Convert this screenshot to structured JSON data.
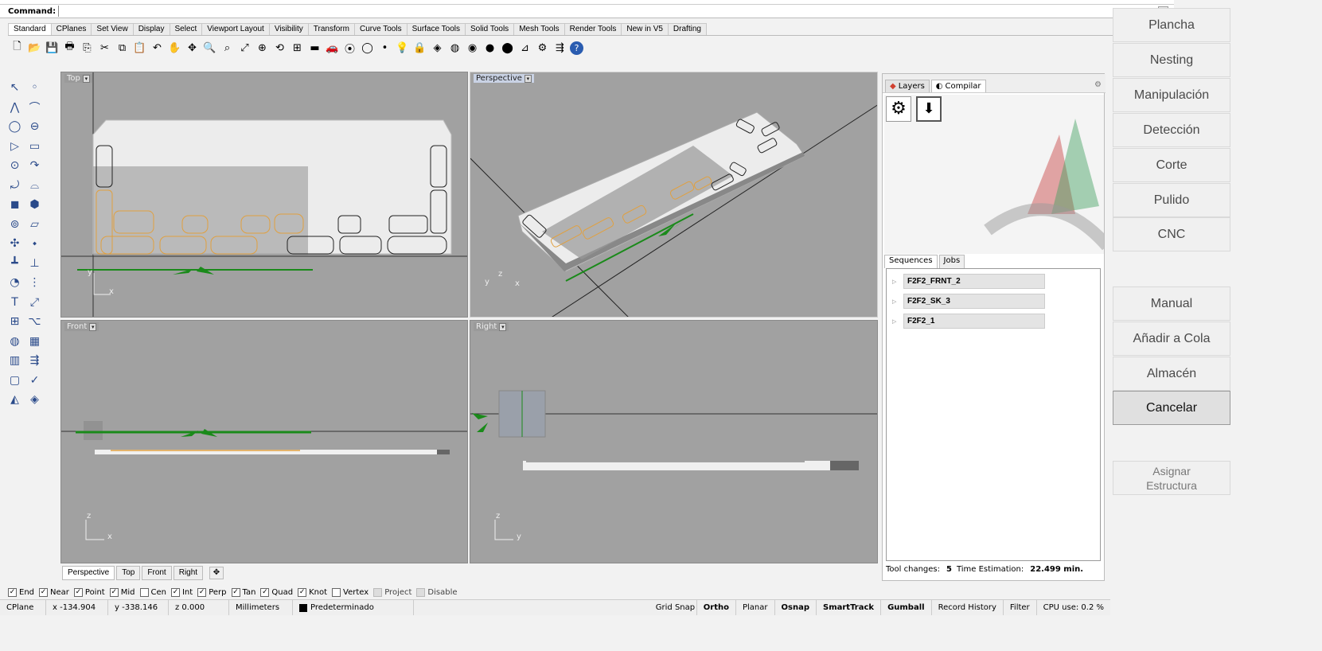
{
  "command": {
    "label": "Command:",
    "value": ""
  },
  "toolbar_tabs": [
    "Standard",
    "CPlanes",
    "Set View",
    "Display",
    "Select",
    "Viewport Layout",
    "Visibility",
    "Transform",
    "Curve Tools",
    "Surface Tools",
    "Solid Tools",
    "Mesh Tools",
    "Render Tools",
    "New in V5",
    "Drafting"
  ],
  "toolbar_icons": [
    "new-file",
    "open-file",
    "save",
    "print",
    "import",
    "cut",
    "copy",
    "paste",
    "undo",
    "pan",
    "rotate-view",
    "zoom",
    "zoom-window",
    "zoom-extents",
    "zoom-selected",
    "rotate",
    "grid",
    "shade",
    "car",
    "osnap-group",
    "circle",
    "point",
    "light",
    "lock",
    "layers",
    "render",
    "color",
    "sphere",
    "sphere-dark",
    "dimension",
    "gear",
    "flow",
    "help"
  ],
  "palette_icons": [
    "select-arrow",
    "point",
    "polyline",
    "curve-pts",
    "circle",
    "ellipse",
    "polygon",
    "rectangle",
    "arc",
    "fillet",
    "bend",
    "surface",
    "box",
    "sphere",
    "cylinder",
    "extrude",
    "boolean",
    "fillet-edge",
    "group",
    "orient",
    "move",
    "rotate-3d",
    "text",
    "dim",
    "grid-array",
    "explode",
    "solid",
    "bounding",
    "matrix",
    "lineup",
    "analyze",
    "check",
    "mesh",
    "paint"
  ],
  "viewports": {
    "top": {
      "label": "Top",
      "ax1": "y",
      "ax2": "x"
    },
    "perspective": {
      "label": "Perspective",
      "ax1": "z",
      "ax2": "x",
      "ax3": "y"
    },
    "front": {
      "label": "Front",
      "ax1": "z",
      "ax2": "x"
    },
    "right": {
      "label": "Right",
      "ax1": "z",
      "ax2": "y"
    }
  },
  "viewport_tabs": [
    "Perspective",
    "Top",
    "Front",
    "Right"
  ],
  "panel": {
    "tabs": [
      "Layers",
      "Compilar"
    ],
    "sub_tabs": [
      "Sequences",
      "Jobs"
    ],
    "sequences": [
      "F2F2_FRNT_2",
      "F2F2_SK_3",
      "F2F2_1"
    ],
    "tool_changes_label": "Tool changes:",
    "tool_changes_value": "5",
    "time_label": "Time Estimation:",
    "time_value": "22.499 min."
  },
  "osnap": [
    {
      "label": "End",
      "checked": true
    },
    {
      "label": "Near",
      "checked": true
    },
    {
      "label": "Point",
      "checked": true
    },
    {
      "label": "Mid",
      "checked": true
    },
    {
      "label": "Cen",
      "checked": false
    },
    {
      "label": "Int",
      "checked": true
    },
    {
      "label": "Perp",
      "checked": true
    },
    {
      "label": "Tan",
      "checked": true
    },
    {
      "label": "Quad",
      "checked": true
    },
    {
      "label": "Knot",
      "checked": true
    },
    {
      "label": "Vertex",
      "checked": false
    },
    {
      "label": "Project",
      "checked": false,
      "disabled": true
    },
    {
      "label": "Disable",
      "checked": false,
      "disabled": true
    }
  ],
  "status": {
    "cplane": "CPlane",
    "x": "x -134.904",
    "y": "y -338.146",
    "z": "z 0.000",
    "units": "Millimeters",
    "layer": "Predeterminado",
    "grid_snap": "Grid Snap",
    "ortho": "Ortho",
    "planar": "Planar",
    "osnap": "Osnap",
    "smarttrack": "SmartTrack",
    "gumball": "Gumball",
    "record": "Record History",
    "filter": "Filter",
    "cpu": "CPU use: 0.2 %"
  },
  "app_buttons": [
    "Plancha",
    "Nesting",
    "Manipulación",
    "Detección",
    "Corte",
    "Pulido",
    "CNC",
    "Manual",
    "Añadir a Cola",
    "Almacén",
    "Cancelar"
  ],
  "assign_button": [
    "Asignar",
    "Estructura"
  ],
  "colors": {
    "viewport_bg": "#a1a1a1",
    "part_fill": "#ececec",
    "tool_path": "#e0a040",
    "green": "#1a8a1a"
  }
}
